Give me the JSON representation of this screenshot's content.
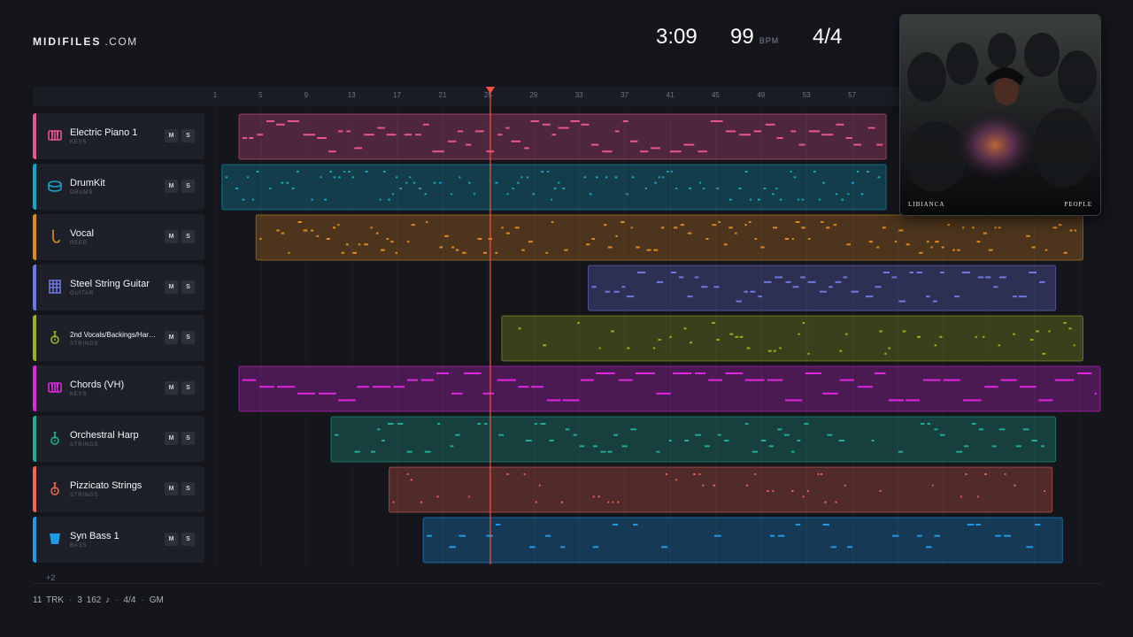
{
  "brand": {
    "name": "MIDIFILES",
    "suffix": ".COM"
  },
  "stats": {
    "duration": "3:09",
    "tempo": "99",
    "tempo_unit": "BPM",
    "time_signature": "4/4"
  },
  "ruler": {
    "bars": [
      "1",
      "5",
      "9",
      "13",
      "17",
      "21",
      "25",
      "29",
      "33",
      "37",
      "41",
      "45",
      "49",
      "53",
      "57"
    ]
  },
  "playhead": {
    "bar": 25.2,
    "color": "#ff4d3d"
  },
  "tracks": [
    {
      "name": "Electric Piano 1",
      "category": "KEYS",
      "icon": "piano-icon",
      "color": "#e9558f",
      "mute": "M",
      "solo": "S",
      "clip": {
        "start": 3.1,
        "end": 60
      }
    },
    {
      "name": "DrumKit",
      "category": "DRUMS",
      "icon": "drum-icon",
      "color": "#16a6c4",
      "mute": "M",
      "solo": "S",
      "clip": {
        "start": 1.6,
        "end": 60
      }
    },
    {
      "name": "Vocal",
      "category": "REED",
      "icon": "saxophone-icon",
      "color": "#e08a1e",
      "mute": "M",
      "solo": "S",
      "clip": {
        "start": 4.6,
        "end": 77.3
      }
    },
    {
      "name": "Steel String Guitar",
      "category": "GUITAR",
      "icon": "guitar-fretboard-icon",
      "color": "#6f78e0",
      "mute": "M",
      "solo": "S",
      "clip": {
        "start": 33.8,
        "end": 74.9
      }
    },
    {
      "name": "2nd Vocals/Backings/Harmonies",
      "category": "STRINGS",
      "icon": "guitar-icon",
      "color": "#9ab31c",
      "mute": "M",
      "solo": "S",
      "clip": {
        "start": 26.2,
        "end": 77.3
      }
    },
    {
      "name": "Chords (VH)",
      "category": "KEYS",
      "icon": "piano-icon",
      "color": "#e026e0",
      "mute": "M",
      "solo": "S",
      "clip": {
        "start": 3.1,
        "end": 78.9
      }
    },
    {
      "name": "Orchestral Harp",
      "category": "STRINGS",
      "icon": "guitar-icon",
      "color": "#1fae93",
      "mute": "M",
      "solo": "S",
      "clip": {
        "start": 11.2,
        "end": 74.9
      }
    },
    {
      "name": "Pizzicato Strings",
      "category": "STRINGS",
      "icon": "guitar-icon",
      "color": "#f0664e",
      "mute": "M",
      "solo": "S",
      "clip": {
        "start": 16.3,
        "end": 74.6
      }
    },
    {
      "name": "Syn Bass 1",
      "category": "BASS",
      "icon": "bass-icon",
      "color": "#1e9be8",
      "mute": "M",
      "solo": "S",
      "clip": {
        "start": 19.3,
        "end": 75.5
      }
    }
  ],
  "more_tracks": "+2",
  "footer": {
    "tracks": "11 TRK",
    "notes": "3 162 ♪",
    "time_signature": "4/4",
    "standard": "GM"
  },
  "album": {
    "artist": "LIBIANCA",
    "title": "PEOPLE"
  }
}
